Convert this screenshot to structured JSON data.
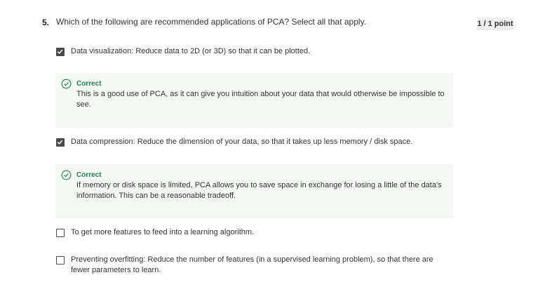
{
  "question": {
    "number": "5.",
    "text": "Which of the following are recommended applications of PCA? Select all that apply.",
    "points": "1 / 1 point"
  },
  "options": [
    {
      "label": "Data visualization: Reduce data to 2D (or 3D) so that it can be plotted.",
      "checked": true,
      "feedback": {
        "title": "Correct",
        "text": "This is a good use of PCA, as it can give you intuition about your data that would otherwise be impossible to see."
      }
    },
    {
      "label": "Data compression: Reduce the dimension of your data, so that it takes up less memory / disk space.",
      "checked": true,
      "feedback": {
        "title": "Correct",
        "text": "If memory or disk space is limited, PCA allows you to save space in exchange for losing a little of the data's information. This can be a reasonable tradeoff."
      }
    },
    {
      "label": "To get more features to feed into a learning algorithm.",
      "checked": false
    },
    {
      "label": "Preventing overfitting: Reduce the number of features (in a supervised learning problem), so that there are fewer parameters to learn.",
      "checked": false
    }
  ],
  "colors": {
    "correct": "#1f8354",
    "feedback_bg": "#f5f8f5",
    "checkbox": "#4a4a4a"
  },
  "icons": {
    "checkmark": "check-icon",
    "correct": "check-circle-icon"
  }
}
